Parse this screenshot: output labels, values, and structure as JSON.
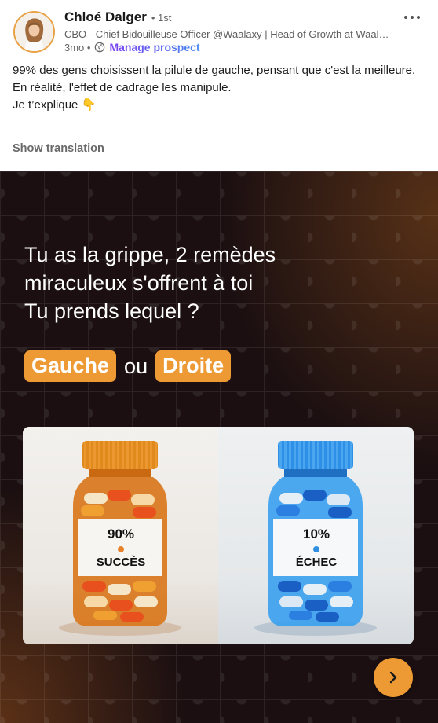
{
  "author": {
    "name": "Chloé Dalger",
    "degree": "• 1st",
    "headline": "CBO - Chief Bidouilleuse Officer @Waalaxy | Head of Growth at Waalaxy",
    "time": "3mo •",
    "manage_label": "Manage prospect"
  },
  "post": {
    "lines": [
      "99% des gens choisissent la pilule de gauche, pensant que c'est la meilleure.",
      "En réalité, l'effet de cadrage les manipule.",
      "Je t’explique 👇"
    ],
    "show_translation": "Show translation"
  },
  "slide": {
    "title_lines": [
      "Tu as la grippe, 2 remèdes",
      "miraculeux s'offrent à toi",
      "Tu prends lequel ?"
    ],
    "choice_left": "Gauche",
    "choice_or": "ou",
    "choice_right": "Droite",
    "left_bottle": {
      "value": "90%",
      "word": "SUCCÈS",
      "dot_color": "#e8822a"
    },
    "right_bottle": {
      "value": "10%",
      "word": "ÉCHEC",
      "dot_color": "#2f8fe0"
    }
  },
  "icons": {
    "more": "more-horizontal-icon",
    "globe": "globe-icon",
    "next": "chevron-right-icon"
  },
  "colors": {
    "accent_orange": "#ee9a34",
    "slide_background": "#1b0f11",
    "manage_purple": "#7b5cf5"
  }
}
